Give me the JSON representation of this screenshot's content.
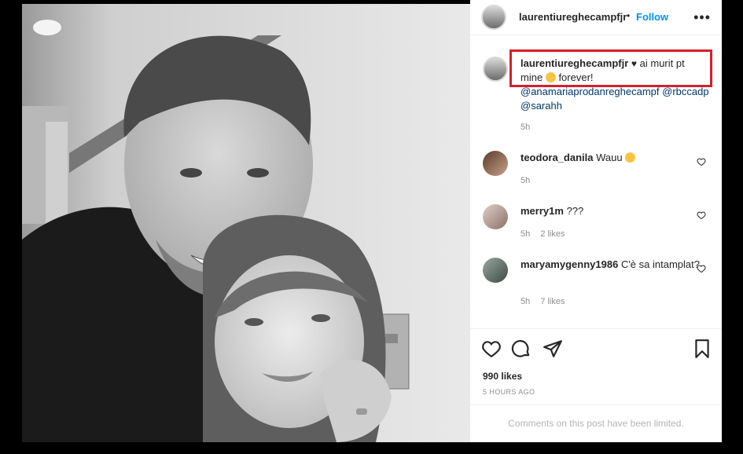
{
  "post": {
    "username": "laurentiureghecampfjr",
    "follow_label": "Follow",
    "separator": "•",
    "caption_text_1": "ai murit pt",
    "caption_text_2": "mine",
    "caption_text_3": "forever!",
    "mentions_1": "@anamariaprodanreghecampf @rbccadp",
    "mentions_2": "@sarahh",
    "caption_time": "5h",
    "likes": "990 likes",
    "time_ago": "5 HOURS AGO",
    "comments_limited": "Comments on this post have been limited."
  },
  "comments": [
    {
      "username": "teodora_danila",
      "text": "Wauu",
      "time": "5h",
      "likes": ""
    },
    {
      "username": "merry1m",
      "text": "???",
      "time": "5h",
      "likes": "2 likes"
    },
    {
      "username": "maryamygenny1986",
      "text": "C'è sa intamplat?",
      "time": "5h",
      "likes": "7 likes"
    }
  ],
  "icons": {
    "more": "more-options-icon",
    "like": "heart-icon",
    "comment": "comment-icon",
    "share": "share-icon",
    "save": "bookmark-icon"
  },
  "colors": {
    "follow": "#0095f6",
    "highlight_box": "#d3202c"
  }
}
